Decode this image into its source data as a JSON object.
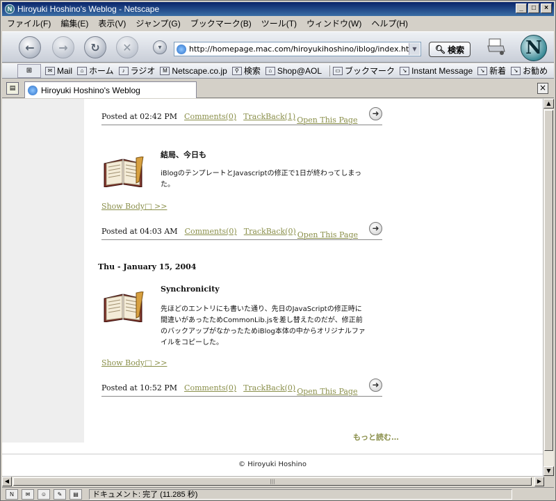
{
  "window": {
    "title": "Hiroyuki Hoshino's Weblog - Netscape"
  },
  "menu": [
    "ファイル(F)",
    "編集(E)",
    "表示(V)",
    "ジャンプ(G)",
    "ブックマーク(B)",
    "ツール(T)",
    "ウィンドウ(W)",
    "ヘルプ(H)"
  ],
  "navbar": {
    "url": "http://homepage.mac.com/hiroyukihoshino/iblog/index.html",
    "search_label": "検索"
  },
  "personal_toolbar": [
    "Mail",
    "ホーム",
    "ラジオ",
    "Netscape.co.jp",
    "検索",
    "Shop@AOL",
    "ブックマーク",
    "Instant Message",
    "新着",
    "お勧め"
  ],
  "tab": {
    "title": "Hiroyuki Hoshino's Weblog"
  },
  "posts": [
    {
      "posted": "Posted at 02:42 PM",
      "comments": "Comments(0)",
      "trackback": "TrackBack(1)",
      "open": "Open This Page"
    },
    {
      "title": "結局、今日も",
      "body": "iBlogのテンプレートとJavascriptの修正で1日が終わってしまった。",
      "show_body": "Show Body□ >>",
      "posted": "Posted at 04:03 AM",
      "comments": "Comments(0)",
      "trackback": "TrackBack(0)",
      "open": "Open This Page"
    },
    {
      "date": "Thu - January 15, 2004",
      "title": "Synchronicity",
      "body": "先ほどのエントリにも書いた通り、先日のJavaScriptの修正時に間違いがあったためCommonLib.jsを差し替えたのだが、修正前のバックアップがなかったためiBlog本体の中からオリジナルファイルをコピーした。",
      "show_body": "Show Body□ >>",
      "posted": "Posted at 10:52 PM",
      "comments": "Comments(0)",
      "trackback": "TrackBack(0)",
      "open": "Open This Page"
    }
  ],
  "more_link": "もっと読む…",
  "footer": "© Hiroyuki Hoshino",
  "status": "ドキュメント: 完了 (11.285 秒)"
}
